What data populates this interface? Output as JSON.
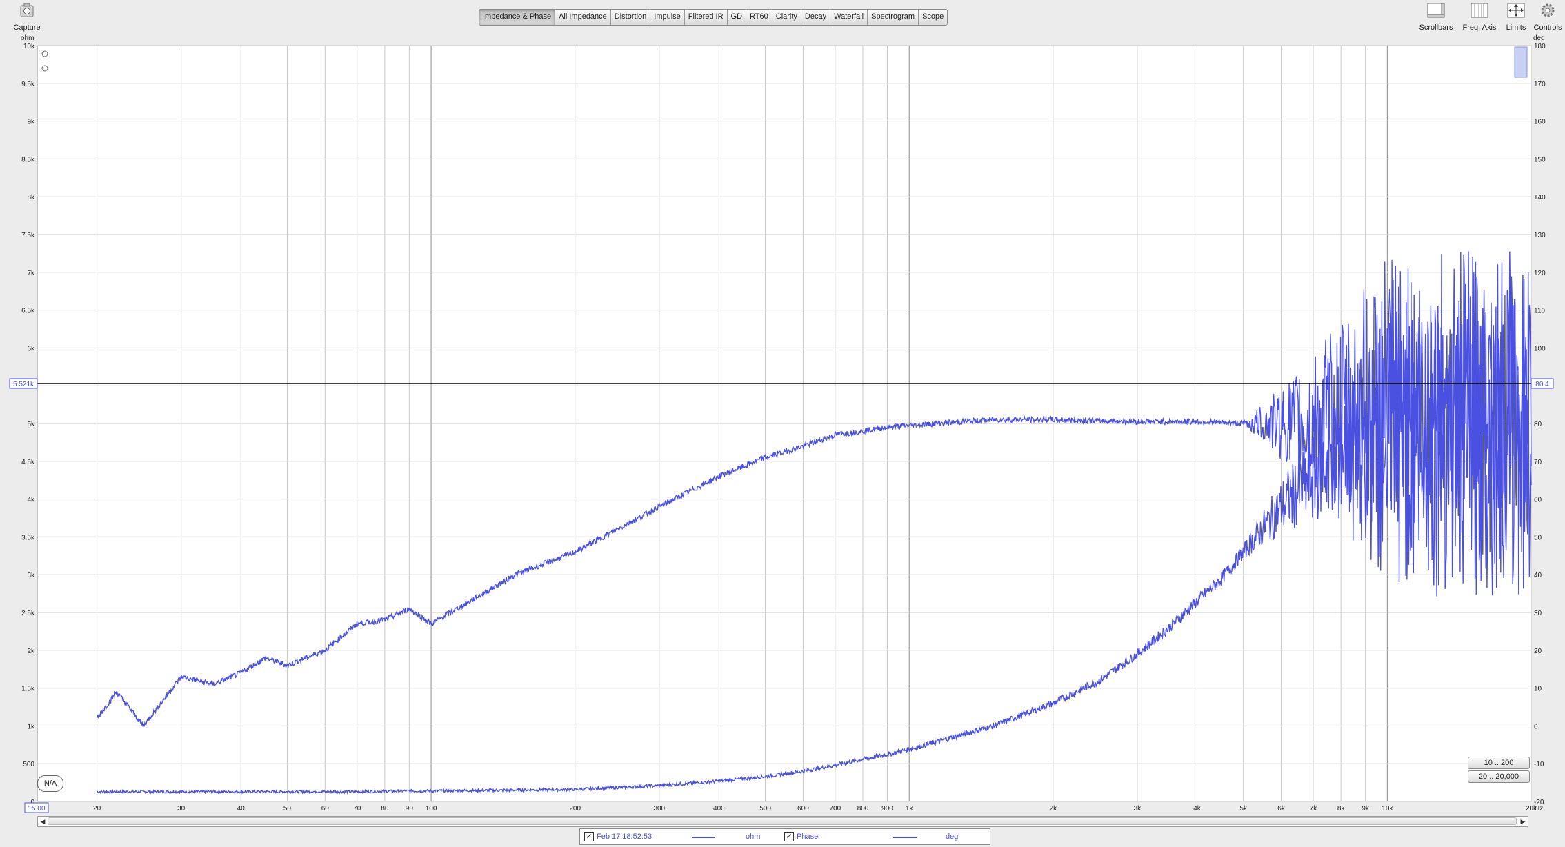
{
  "toolbar": {
    "capture": {
      "label": "Capture",
      "icon": "camera-icon"
    },
    "scrollbars": {
      "label": "Scrollbars",
      "icon": "scrollbars-icon"
    },
    "freq_axis": {
      "label": "Freq. Axis",
      "icon": "freq-axis-icon"
    },
    "limits": {
      "label": "Limits",
      "icon": "limits-icon"
    },
    "controls": {
      "label": "Controls",
      "icon": "gear-icon"
    },
    "tabs": [
      "Impedance & Phase",
      "All Impedance",
      "Distortion",
      "Impulse",
      "Filtered IR",
      "GD",
      "RT60",
      "Clarity",
      "Decay",
      "Waterfall",
      "Spectrogram",
      "Scope"
    ],
    "active_tab": "Impedance & Phase"
  },
  "graph": {
    "left_unit": "ohm",
    "right_unit": "deg",
    "cursor_left_value": "5.521k",
    "cursor_right_value": "80.4",
    "freq_start_value": "15.00",
    "freq_unit": "Hz",
    "na_label": "N/A",
    "range_buttons": [
      "10 .. 200",
      "20 .. 20,000"
    ]
  },
  "legend": {
    "date": "Feb 17 18:52:53",
    "ohm_label": "ohm",
    "phase_label": "Phase",
    "deg_label": "deg"
  },
  "colors": {
    "trace": "#4a50e0",
    "grid": "#c8c8c8",
    "plot_bg": "#ffffff",
    "cursor": "#000000"
  },
  "chart_data": {
    "type": "line",
    "x_scale": "log",
    "xlim": [
      15,
      20000
    ],
    "xlabel": "Hz",
    "x_ticks": [
      "20",
      "30",
      "40",
      "50",
      "60",
      "70",
      "80",
      "90",
      "100",
      "200",
      "300",
      "400",
      "500",
      "600",
      "700",
      "800",
      "900",
      "1k",
      "2k",
      "3k",
      "4k",
      "5k",
      "6k",
      "7k",
      "8k",
      "9k",
      "10k",
      "20k"
    ],
    "x_tick_values": [
      20,
      30,
      40,
      50,
      60,
      70,
      80,
      90,
      100,
      200,
      300,
      400,
      500,
      600,
      700,
      800,
      900,
      1000,
      2000,
      3000,
      4000,
      5000,
      6000,
      7000,
      8000,
      9000,
      10000,
      20000
    ],
    "y_left": {
      "label": "ohm",
      "ylim": [
        0,
        10000
      ],
      "ticks": [
        "0",
        "500",
        "1k",
        "1.5k",
        "2k",
        "2.5k",
        "3k",
        "3.5k",
        "4k",
        "4.5k",
        "5k",
        "5.5k",
        "6k",
        "6.5k",
        "7k",
        "7.5k",
        "8k",
        "8.5k",
        "9k",
        "9.5k",
        "10k"
      ],
      "tick_values": [
        0,
        500,
        1000,
        1500,
        2000,
        2500,
        3000,
        3500,
        4000,
        4500,
        5000,
        5500,
        6000,
        6500,
        7000,
        7500,
        8000,
        8500,
        9000,
        9500,
        10000
      ]
    },
    "y_right": {
      "label": "deg",
      "ylim": [
        -20,
        180
      ],
      "ticks": [
        "-20",
        "-10",
        "0",
        "10",
        "20",
        "30",
        "40",
        "50",
        "60",
        "70",
        "80",
        "90",
        "100",
        "110",
        "120",
        "130",
        "140",
        "150",
        "160",
        "170",
        "180"
      ],
      "tick_values": [
        -20,
        -10,
        0,
        10,
        20,
        30,
        40,
        50,
        60,
        70,
        80,
        90,
        100,
        110,
        120,
        130,
        140,
        150,
        160,
        170,
        180
      ]
    },
    "series": [
      {
        "name": "ohm",
        "axis": "left",
        "x": [
          20,
          30,
          40,
          50,
          60,
          70,
          80,
          90,
          100,
          150,
          200,
          300,
          400,
          500,
          600,
          700,
          800,
          900,
          1000,
          1500,
          2000,
          2500,
          3000,
          3500,
          4000,
          4500,
          5000,
          6000,
          7000,
          8000,
          10000,
          15000,
          20000
        ],
        "y": [
          130,
          130,
          130,
          130,
          130,
          130,
          135,
          140,
          140,
          150,
          160,
          210,
          270,
          330,
          400,
          480,
          560,
          620,
          690,
          1000,
          1300,
          1600,
          1950,
          2300,
          2650,
          2950,
          3300,
          3900,
          4300,
          4700,
          5000,
          5200,
          5300
        ]
      },
      {
        "name": "deg",
        "axis": "right",
        "x": [
          20,
          22,
          25,
          30,
          35,
          40,
          45,
          50,
          60,
          70,
          80,
          90,
          100,
          150,
          200,
          300,
          400,
          500,
          600,
          700,
          800,
          900,
          1000,
          1500,
          2000,
          3000,
          4000,
          5000,
          6000,
          7000,
          8000,
          10000,
          15000,
          20000
        ],
        "y": [
          2,
          9,
          0,
          13,
          11,
          14,
          18,
          16,
          20,
          27,
          28,
          31,
          27,
          40,
          46,
          58,
          66,
          71,
          74,
          77,
          78,
          79,
          79.5,
          81,
          81,
          80.5,
          80.5,
          80,
          80,
          80,
          80,
          80,
          80,
          80
        ]
      }
    ]
  }
}
